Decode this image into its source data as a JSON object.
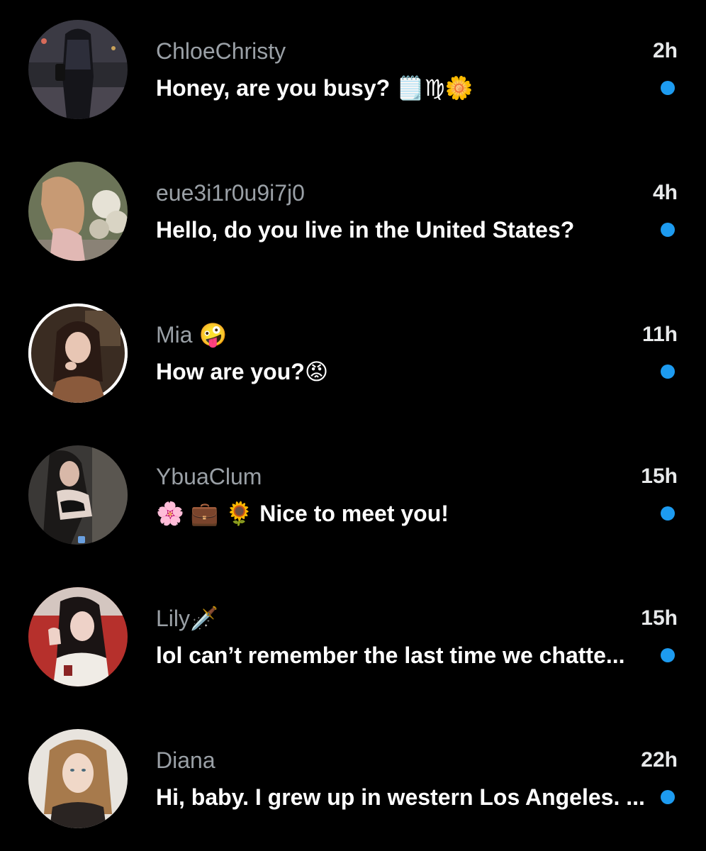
{
  "accent_color": "#1d9bf0",
  "conversations": [
    {
      "name": "ChloeChristy",
      "time": "2h",
      "preview": "Honey, are you busy? 🗒️♍🌼",
      "unread": true,
      "avatar_icon": "avatar-woman-night-street"
    },
    {
      "name": "eue3i1r0u9i7j0",
      "time": "4h",
      "preview": "Hello, do you live in the United States?",
      "unread": true,
      "avatar_icon": "avatar-woman-flowers"
    },
    {
      "name": "Mia 🤪",
      "time": "11h",
      "preview": "How are you?😡",
      "unread": true,
      "avatar_icon": "avatar-woman-portrait"
    },
    {
      "name": "YbuaClum",
      "time": "15h",
      "preview": "🌸 💼 🌻 Nice to meet you!",
      "unread": true,
      "avatar_icon": "avatar-woman-mirror-selfie"
    },
    {
      "name": "Lily🗡️",
      "time": "15h",
      "preview": "lol can’t remember the last time we chatte...",
      "unread": true,
      "avatar_icon": "avatar-woman-dark-hair"
    },
    {
      "name": "Diana",
      "time": "22h",
      "preview": "Hi, baby. I grew up in western Los Angeles. ...",
      "unread": true,
      "avatar_icon": "avatar-woman-blonde"
    }
  ]
}
